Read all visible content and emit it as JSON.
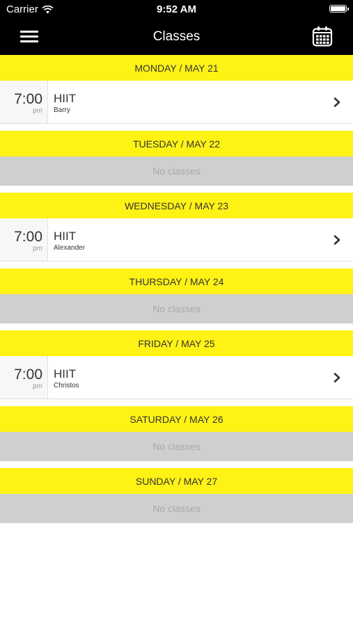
{
  "status_bar": {
    "carrier": "Carrier",
    "time": "9:52 AM",
    "icons": [
      "wifi-icon",
      "battery-icon"
    ]
  },
  "nav": {
    "title": "Classes",
    "left_icon": "hamburger-menu-icon",
    "right_icon": "calendar-icon"
  },
  "days": [
    {
      "header": "MONDAY / MAY 21",
      "class": {
        "time": "7:00",
        "period": "pm",
        "name": "HIIT",
        "instructor": "Barry"
      }
    },
    {
      "header": "TUESDAY / MAY 22",
      "empty_text": "No classes"
    },
    {
      "header": "WEDNESDAY / MAY 23",
      "class": {
        "time": "7:00",
        "period": "pm",
        "name": "HIIT",
        "instructor": "Alexander"
      }
    },
    {
      "header": "THURSDAY / MAY 24",
      "empty_text": "No classes"
    },
    {
      "header": "FRIDAY / MAY 25",
      "class": {
        "time": "7:00",
        "period": "pm",
        "name": "HIIT",
        "instructor": "Christos"
      }
    },
    {
      "header": "SATURDAY / MAY 26",
      "empty_text": "No classes"
    },
    {
      "header": "SUNDAY / MAY 27",
      "empty_text": "No classes"
    }
  ],
  "colors": {
    "header_bar": "#000000",
    "day_header": "#fff215",
    "empty_row": "#cfcfcf",
    "empty_text": "#a9a9a9"
  }
}
